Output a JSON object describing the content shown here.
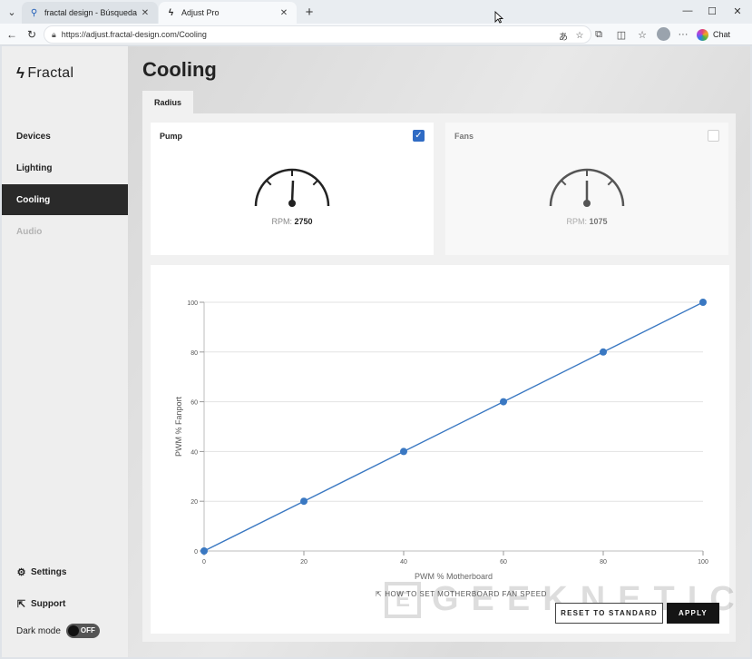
{
  "browser": {
    "tabs": [
      {
        "label": "fractal design - Búsqueda",
        "icon": "search-icon"
      },
      {
        "label": "Adjust Pro",
        "icon": "fractal-logo-icon"
      }
    ],
    "url": "https://adjust.fractal-design.com/Cooling",
    "chat_label": "Chat"
  },
  "sidebar": {
    "brand": "Fractal",
    "items": [
      {
        "label": "Devices",
        "state": "normal"
      },
      {
        "label": "Lighting",
        "state": "normal"
      },
      {
        "label": "Cooling",
        "state": "active"
      },
      {
        "label": "Audio",
        "state": "disabled"
      }
    ],
    "settings_label": "Settings",
    "support_label": "Support",
    "dark_mode_label": "Dark mode",
    "dark_mode_state": "OFF"
  },
  "main": {
    "title": "Cooling",
    "subtab": "Radius",
    "pump": {
      "title": "Pump",
      "checked": true,
      "rpm_label": "RPM:",
      "rpm_value": "2750"
    },
    "fans": {
      "title": "Fans",
      "checked": false,
      "rpm_label": "RPM:",
      "rpm_value": "1075"
    },
    "howto_label": "HOW TO SET MOTHERBOARD FAN SPEED",
    "reset_label": "RESET TO STANDARD",
    "apply_label": "APPLY",
    "watermark": "GEEKNETIC"
  },
  "colors": {
    "accent": "#2f6bc4",
    "active_nav": "#2a2a2a",
    "line": "#3a78c2"
  },
  "chart_data": {
    "type": "line",
    "xlabel": "PWM % Motherboard",
    "ylabel": "PWM % Fanport",
    "x": [
      0,
      20,
      40,
      60,
      80,
      100
    ],
    "series": [
      {
        "values": [
          0,
          20,
          40,
          60,
          80,
          100
        ]
      }
    ],
    "xticks": [
      0,
      20,
      40,
      60,
      80,
      100
    ],
    "yticks": [
      0,
      20,
      40,
      60,
      80,
      100
    ],
    "xlim": [
      0,
      100
    ],
    "ylim": [
      0,
      100
    ],
    "grid": true
  }
}
